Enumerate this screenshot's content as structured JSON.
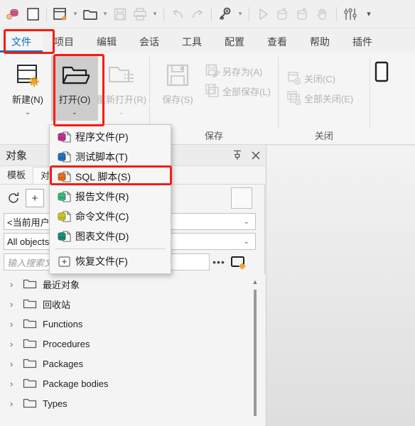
{
  "toolbar": {
    "items": [
      {
        "name": "connections-icon",
        "label": "连接"
      },
      {
        "name": "new-window-blank-icon",
        "label": "新建空白窗口"
      },
      {
        "name": "new-window-icon",
        "label": "新建窗口"
      },
      {
        "name": "new-window-dropdown-caret",
        "label": "▾"
      },
      {
        "name": "open-folder-icon",
        "label": "打开"
      },
      {
        "name": "open-dropdown-caret",
        "label": "▾"
      },
      {
        "name": "save-icon",
        "label": "保存"
      },
      {
        "name": "print-icon",
        "label": "打印"
      },
      {
        "name": "print-dropdown-caret",
        "label": "▾"
      },
      {
        "name": "undo-icon",
        "label": "撤销"
      },
      {
        "name": "redo-icon",
        "label": "重做"
      },
      {
        "name": "key-icon",
        "label": "登录"
      },
      {
        "name": "key-dropdown-caret",
        "label": "▾"
      },
      {
        "name": "execute-play-icon",
        "label": "执行"
      },
      {
        "name": "commit-icon",
        "label": "提交"
      },
      {
        "name": "rollback-icon",
        "label": "回滚"
      },
      {
        "name": "stop-hand-icon",
        "label": "中断"
      },
      {
        "name": "preferences-sliders-icon",
        "label": "首选项"
      },
      {
        "name": "toolbar-overflow-caret",
        "label": "▾"
      }
    ]
  },
  "ribbon_tabs": [
    {
      "label": "文件",
      "active": true
    },
    {
      "label": "项目",
      "active": false
    },
    {
      "label": "编辑",
      "active": false
    },
    {
      "label": "会话",
      "active": false
    },
    {
      "label": "工具",
      "active": false
    },
    {
      "label": "配置",
      "active": false
    },
    {
      "label": "查看",
      "active": false
    },
    {
      "label": "帮助",
      "active": false
    },
    {
      "label": "插件",
      "active": false
    }
  ],
  "ribbon": {
    "group_file": {
      "buttons": [
        {
          "label": "新建(N)",
          "dropdown": "⌄",
          "state": "enabled",
          "icon": "new-document-icon"
        },
        {
          "label": "打开(O)",
          "dropdown": "⌄",
          "state": "active",
          "icon": "open-folder-icon"
        },
        {
          "label": "重新打开(R)",
          "dropdown": "⌄",
          "state": "disabled",
          "icon": "reopen-folder-icon"
        }
      ]
    },
    "group_save": {
      "label": "保存",
      "big": {
        "label": "保存(S)",
        "state": "disabled",
        "icon": "save-diskette-icon"
      },
      "small": [
        {
          "label": "另存为(A)",
          "state": "disabled",
          "icon": "save-as-icon"
        },
        {
          "label": "全部保存(L)",
          "state": "disabled",
          "icon": "save-all-icon"
        }
      ]
    },
    "group_close": {
      "label": "关闭",
      "small": [
        {
          "label": "关闭(C)",
          "state": "disabled",
          "icon": "close-window-icon"
        },
        {
          "label": "全部关闭(E)",
          "state": "disabled",
          "icon": "close-all-windows-icon"
        }
      ]
    }
  },
  "open_menu": {
    "items": [
      {
        "label": "程序文件(P)",
        "icon": "program-file-icon",
        "color": "#c2338f"
      },
      {
        "label": "测试脚本(T)",
        "icon": "test-script-file-icon",
        "color": "#1f72c0"
      },
      {
        "label": "SQL 脚本(S)",
        "icon": "sql-script-file-icon",
        "color": "#e8711a",
        "highlighted": true
      },
      {
        "label": "报告文件(R)",
        "icon": "report-file-icon",
        "color": "#3cb878"
      },
      {
        "label": "命令文件(C)",
        "icon": "command-file-icon",
        "color": "#c6c42a"
      },
      {
        "label": "图表文件(D)",
        "icon": "diagram-file-icon",
        "color": "#1b8f7e"
      },
      {
        "label": "恢复文件(F)",
        "icon": "recover-file-icon",
        "color": "#6e6e6e"
      }
    ]
  },
  "panel": {
    "title": "对象",
    "pin_icon": "pin-icon",
    "close_icon": "close-icon",
    "tabs": [
      {
        "label": "模板",
        "active": false
      },
      {
        "label": "对象",
        "active": true
      }
    ],
    "toolbar": [
      {
        "name": "refresh-icon",
        "label": "↻"
      },
      {
        "name": "add-icon",
        "label": "+"
      }
    ],
    "user_combo": {
      "value": "<当前用户>",
      "chevron": "⌄"
    },
    "filter_combo": {
      "value": "All objects",
      "chevron": "⌄"
    },
    "search": {
      "placeholder": "输入搜索文本",
      "value": ""
    },
    "more_button": "•••",
    "new_window_button": "new-window-icon",
    "tree": [
      {
        "label": "最近对象",
        "expander": "›",
        "icon": "folder-icon"
      },
      {
        "label": "回收站",
        "expander": "›",
        "icon": "folder-icon"
      },
      {
        "label": "Functions",
        "expander": "›",
        "icon": "folder-icon"
      },
      {
        "label": "Procedures",
        "expander": "›",
        "icon": "folder-icon"
      },
      {
        "label": "Packages",
        "expander": "›",
        "icon": "folder-icon"
      },
      {
        "label": "Package bodies",
        "expander": "›",
        "icon": "folder-icon"
      },
      {
        "label": "Types",
        "expander": "›",
        "icon": "folder-icon"
      }
    ],
    "scrollbar": {
      "up_arrow": "▲"
    }
  },
  "colors": {
    "accent": "#0c74c4",
    "annotation": "#f71b12",
    "ribbon_bg": "#f5f5f5",
    "panel_bg": "#f4f4f4"
  }
}
